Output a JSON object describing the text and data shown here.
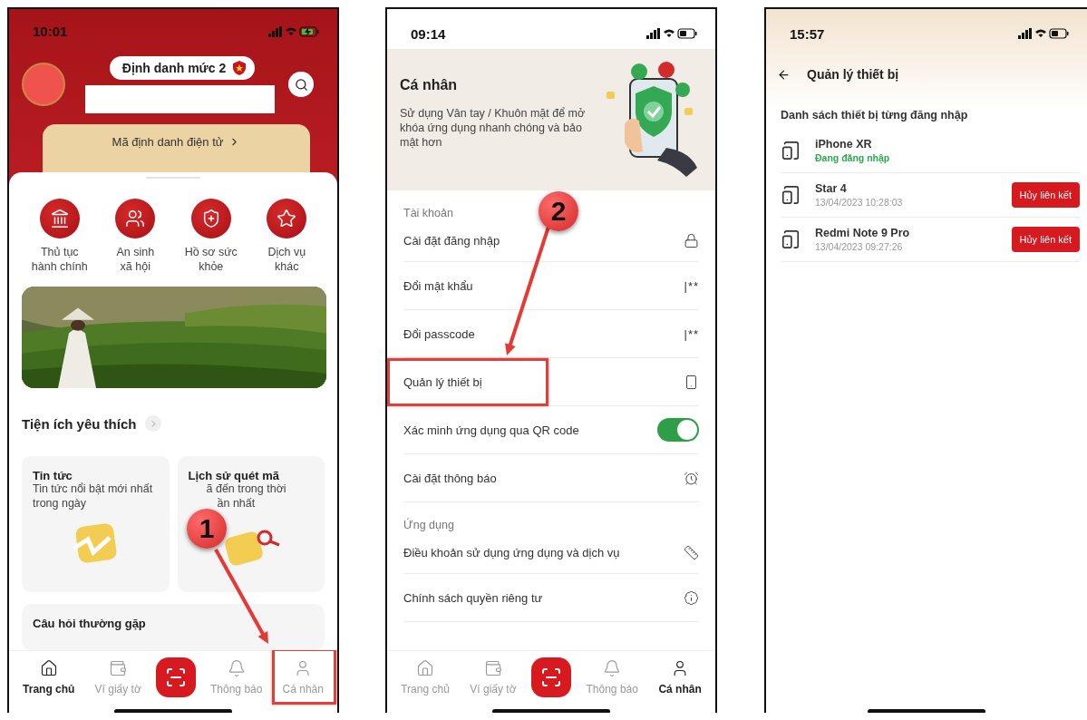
{
  "home_screen": {
    "status": {
      "time": "10:01",
      "charging": true
    },
    "level_badge": "Định danh mức 2",
    "id_card": "Mã định danh điện tử",
    "services": [
      {
        "kind": "building",
        "label": "Thủ tục\nhành chính"
      },
      {
        "kind": "people",
        "label": "An sinh\nxã hội"
      },
      {
        "kind": "shield",
        "label": "Hồ sơ sức\nkhỏe"
      },
      {
        "kind": "star",
        "label": "Dịch vụ\nkhác"
      }
    ],
    "favorites_title": "Tiện ích yêu thích",
    "favorite_cards": [
      {
        "kind": "news",
        "title": "Tin tức",
        "lines": [
          "Tin tức nổi bật mới nhất",
          "trong ngày"
        ]
      },
      {
        "kind": "scan",
        "title": "Lịch sử quét mã",
        "lines": [
          "ã đến trong thời",
          "ần nhất"
        ]
      }
    ],
    "faq_title": "Câu hỏi thường gặp",
    "nav": [
      {
        "kind": "home",
        "label": "Trang chủ",
        "selected": true,
        "highlighted": false
      },
      {
        "kind": "wallet",
        "label": "Ví giấy tờ",
        "selected": false,
        "highlighted": false
      },
      {
        "kind": "scan",
        "selected": false
      },
      {
        "kind": "bell",
        "label": "Thông báo",
        "selected": false,
        "highlighted": false
      },
      {
        "kind": "person",
        "label": "Cá nhân",
        "selected": false,
        "highlighted": true
      }
    ],
    "step": "1"
  },
  "personal_screen": {
    "status": {
      "time": "09:14",
      "charging": false
    },
    "title": "Cá nhân",
    "description": "Sử dụng Vân tay / Khuôn mặt để mở khóa ứng dụng nhanh chóng và bảo mật hơn",
    "sections": [
      {
        "title": "Tài khoản",
        "rows": [
          {
            "kind": "lock",
            "label": "Cài đặt đăng nhập",
            "highlighted": false
          },
          {
            "kind": "mask",
            "label": "Đổi mật khẩu",
            "mask": "|**",
            "highlighted": false
          },
          {
            "kind": "mask",
            "label": "Đổi passcode",
            "mask": "|**",
            "highlighted": false
          },
          {
            "kind": "phone",
            "label": "Quản lý thiết bị",
            "highlighted": true
          },
          {
            "kind": "toggle",
            "label": "Xác minh ứng dụng qua QR code",
            "on": true,
            "highlighted": false
          },
          {
            "kind": "alarm",
            "label": "Cài đặt thông báo",
            "highlighted": false
          }
        ]
      },
      {
        "title": "Ứng dụng",
        "rows": [
          {
            "kind": "ruler",
            "label": "Điều khoản sử dụng ứng dụng và dịch vụ",
            "highlighted": false
          },
          {
            "kind": "privacy",
            "label": "Chính sách quyền riêng tư",
            "highlighted": false
          }
        ]
      }
    ],
    "nav": [
      {
        "kind": "home",
        "label": "Trang chủ",
        "selected": false,
        "highlighted": false
      },
      {
        "kind": "wallet",
        "label": "Ví giấy tờ",
        "selected": false,
        "highlighted": false
      },
      {
        "kind": "scan",
        "selected": false
      },
      {
        "kind": "bell",
        "label": "Thông báo",
        "selected": false,
        "highlighted": false
      },
      {
        "kind": "person",
        "label": "Cá nhân",
        "selected": true,
        "highlighted": false
      }
    ],
    "step": "2"
  },
  "devices_screen": {
    "status": {
      "time": "15:57",
      "charging": false
    },
    "title": "Quản lý thiết bị",
    "list_title": "Danh sách thiết bị từng đăng nhập",
    "devices": [
      {
        "name": "iPhone XR",
        "subtitle": "Đang đăng nhập",
        "current": true
      },
      {
        "name": "Star 4",
        "subtitle": "13/04/2023 10:28:03",
        "current": false,
        "action": "Hủy liên kết"
      },
      {
        "name": "Redmi Note 9 Pro",
        "subtitle": "13/04/2023 09:27:26",
        "current": false,
        "action": "Hủy liên kết"
      }
    ]
  }
}
